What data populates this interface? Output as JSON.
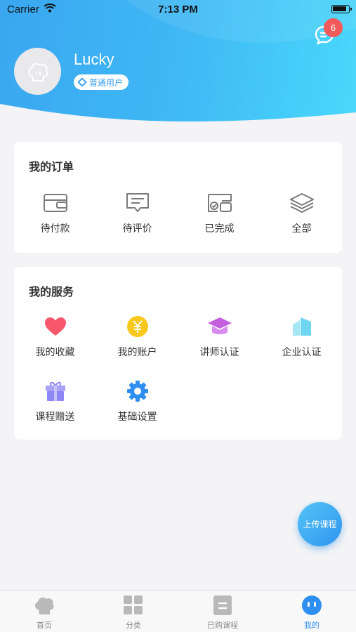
{
  "status_bar": {
    "carrier": "Carrier",
    "time": "7:13 PM"
  },
  "header": {
    "message_badge": "6",
    "username": "Lucky",
    "role": "普通用户"
  },
  "orders": {
    "title": "我的订单",
    "items": [
      {
        "label": "待付款",
        "icon": "wallet-icon"
      },
      {
        "label": "待评价",
        "icon": "comment-icon"
      },
      {
        "label": "已完成",
        "icon": "completed-card-icon"
      },
      {
        "label": "全部",
        "icon": "layers-icon"
      }
    ]
  },
  "services": {
    "title": "我的服务",
    "items": [
      {
        "label": "我的收藏",
        "icon": "heart-icon",
        "color": "#f6576a"
      },
      {
        "label": "我的账户",
        "icon": "yen-coin-icon",
        "color": "#f8c81c"
      },
      {
        "label": "讲师认证",
        "icon": "graduation-cap-icon",
        "color": "#c45fe0"
      },
      {
        "label": "企业认证",
        "icon": "building-icon",
        "color": "#6fd6f2"
      },
      {
        "label": "课程赠送",
        "icon": "gift-icon",
        "color": "#8d86f5"
      },
      {
        "label": "基础设置",
        "icon": "gear-icon",
        "color": "#2f8ff0"
      }
    ]
  },
  "fab": {
    "label": "上传课程"
  },
  "tabbar": {
    "items": [
      {
        "label": "首页",
        "icon": "chef-hat-icon",
        "active": false
      },
      {
        "label": "分类",
        "icon": "grid-icon",
        "active": false
      },
      {
        "label": "已购课程",
        "icon": "document-icon",
        "active": false
      },
      {
        "label": "我的",
        "icon": "smiley-face-icon",
        "active": true
      }
    ]
  },
  "colors": {
    "accent": "#2f8ff0",
    "header_start": "#3aa7f0",
    "header_end": "#49d8fb",
    "badge": "#f25a5a"
  }
}
